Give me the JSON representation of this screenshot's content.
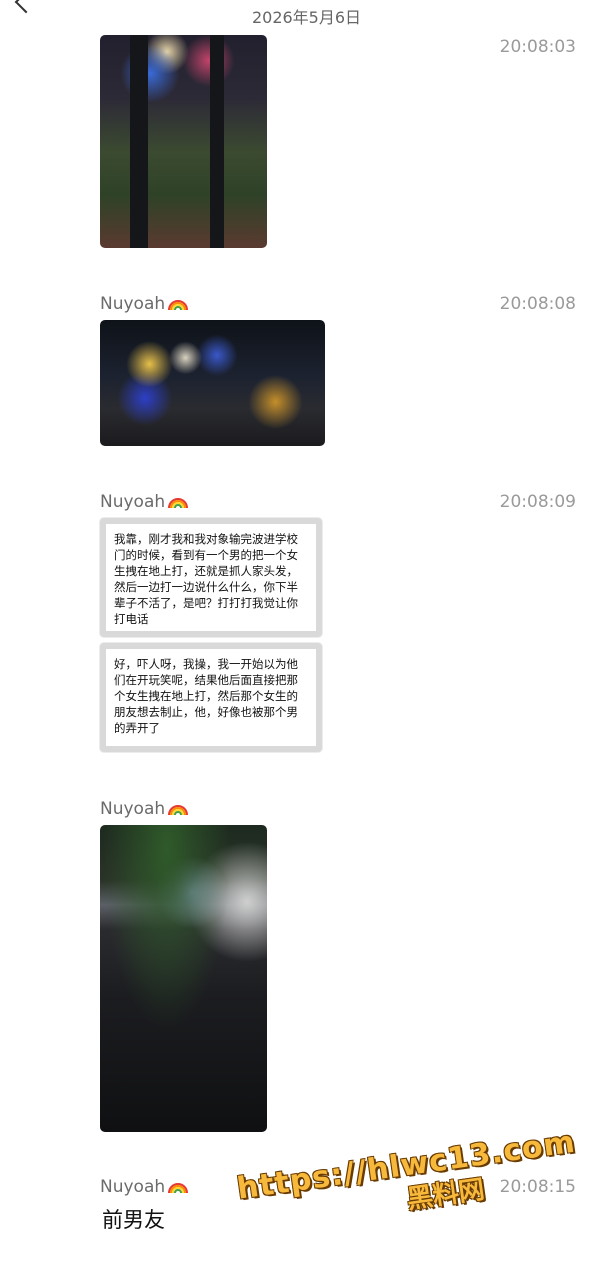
{
  "header": {
    "date": "2026年5月6日"
  },
  "messages": [
    {
      "type": "image",
      "time": "20:08:03"
    },
    {
      "type": "image",
      "sender": "Nuyoah",
      "time": "20:08:08"
    },
    {
      "type": "text-image",
      "sender": "Nuyoah",
      "time": "20:08:09",
      "paragraphs": [
        "我靠，刚才我和我对象输完波进学校门的时候，看到有一个男的把一个女生拽在地上打，还就是抓人家头发，然后一边打一边说什么什么，你下半辈子不活了，是吧？打打打我觉让你打电话",
        "好，吓人呀，我操，我一开始以为他们在开玩笑呢，结果他后面直接把那个女生拽在地上打，然后那个女生的朋友想去制止，他，好像也被那个男的弄开了"
      ]
    },
    {
      "type": "image",
      "sender": "Nuyoah"
    },
    {
      "type": "text",
      "sender": "Nuyoah",
      "time": "20:08:15",
      "text": "前男友"
    }
  ],
  "watermark": {
    "url": "https://hlwc13.com",
    "name": "黑料网"
  },
  "icons": {
    "sender_badge": "rainbow-icon",
    "back": "back-arrow-icon"
  }
}
